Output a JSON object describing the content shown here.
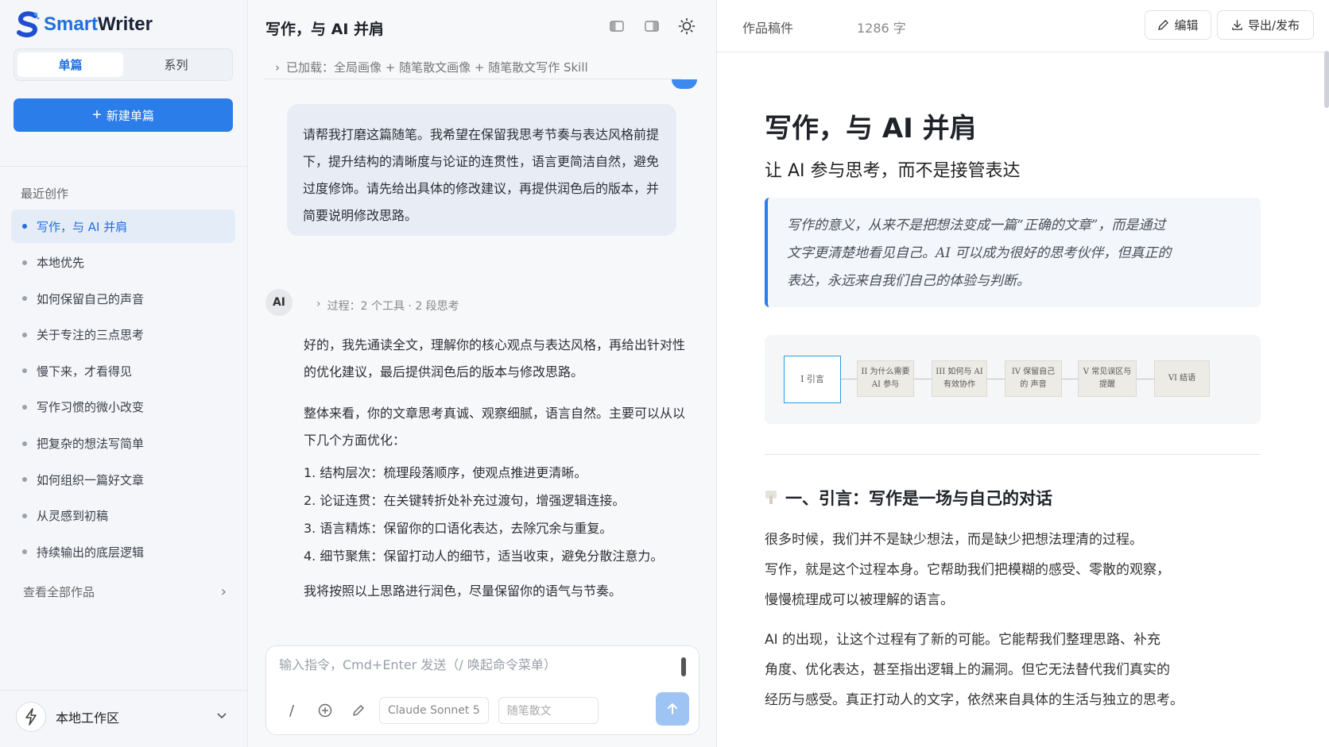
{
  "app": {
    "name_part1": "Smart",
    "name_part2": "Writer"
  },
  "sidebar": {
    "tabs": [
      {
        "label": "单篇"
      },
      {
        "label": "系列"
      }
    ],
    "new_button": "新建单篇",
    "recent_title": "最近创作",
    "recent_items": [
      {
        "label": "写作，与 AI 并肩"
      },
      {
        "label": "本地优先"
      },
      {
        "label": "如何保留自己的声音"
      },
      {
        "label": "关于专注的三点思考"
      },
      {
        "label": "慢下来，才看得见"
      },
      {
        "label": "写作习惯的微小改变"
      },
      {
        "label": "把复杂的想法写简单"
      },
      {
        "label": "如何组织一篇好文章"
      },
      {
        "label": "从灵感到初稿"
      },
      {
        "label": "持续输出的底层逻辑"
      }
    ],
    "view_all": "查看全部作品",
    "workspace": "本地工作区"
  },
  "chat": {
    "title": "写作，与 AI 并肩",
    "loaded_text": "已加载：全局画像 + 随笔散文画像 + 随笔散文写作 Skill",
    "user_message": "请帮我打磨这篇随笔。我希望在保留我思考节奏与表达风格前提下，提升结构的清晰度与论证的连贯性，语言更简洁自然，避免过度修饰。请先给出具体的修改建议，再提供润色后的版本，并简要说明修改思路。",
    "ai_avatar": "AI",
    "ai_process": "过程：2 个工具 · 2 段思考",
    "ai_p1": "好的，我先通读全文，理解你的核心观点与表达风格，再给出针对性的优化建议，最后提供润色后的版本与修改思路。",
    "ai_p2": "整体来看，你的文章思考真诚、观察细腻，语言自然。主要可以从以下几个方面优化：",
    "ai_list": [
      "1.  结构层次：梳理段落顺序，使观点推进更清晰。",
      "2.  论证连贯：在关键转折处补充过渡句，增强逻辑连接。",
      "3.  语言精炼：保留你的口语化表达，去除冗余与重复。",
      "4.  细节聚焦：保留打动人的细节，适当收束，避免分散注意力。"
    ],
    "ai_p3": "我将按照以上思路进行润色，尽量保留你的语气与节奏。",
    "composer_placeholder": "输入指令，Cmd+Enter 发送（/ 唤起命令菜单）",
    "slash_label": "/",
    "model": "Claude Sonnet 5",
    "genre": "随笔散文"
  },
  "doc": {
    "label": "作品稿件",
    "word_count": "1286 字",
    "edit_button": "编辑",
    "export_button": "导出/发布",
    "title": "写作，与 AI 并肩",
    "subtitle": "让 AI 参与思考，而不是接管表达",
    "quote_lines": [
      "写作的意义，从来不是把想法变成一篇“正确的文章”，而是通过",
      "文字更清楚地看见自己。AI 可以成为很好的思考伙伴，但真正的",
      "表达，永远来自我们自己的体验与判断。"
    ],
    "outline": [
      {
        "num": "I",
        "text": "引言"
      },
      {
        "num": "II",
        "text": "为什么需要 AI 参与"
      },
      {
        "num": "III",
        "text": "如何与 AI 有效协作"
      },
      {
        "num": "IV",
        "text": "保留自己的 声音"
      },
      {
        "num": "V",
        "text": "常见误区与 提醒"
      },
      {
        "num": "VI",
        "text": "结语"
      }
    ],
    "section1_title": "一、引言：写作是一场与自己的对话",
    "section1_p1": [
      "很多时候，我们并不是缺少想法，而是缺少把想法理清的过程。",
      "写作，就是这个过程本身。它帮助我们把模糊的感受、零散的观察，",
      "慢慢梳理成可以被理解的语言。"
    ],
    "section1_p2": [
      "AI 的出现，让这个过程有了新的可能。它能帮我们整理思路、补充",
      "角度、优化表达，甚至指出逻辑上的漏洞。但它无法替代我们真实的",
      "经历与感受。真正打动人的文字，依然来自具体的生活与独立的思考。"
    ]
  },
  "colors": {
    "accent": "#2b7de9",
    "active_bg": "#e4ecf8",
    "bubble": "#e8edf5",
    "send_disabled": "#9ec4f3"
  }
}
